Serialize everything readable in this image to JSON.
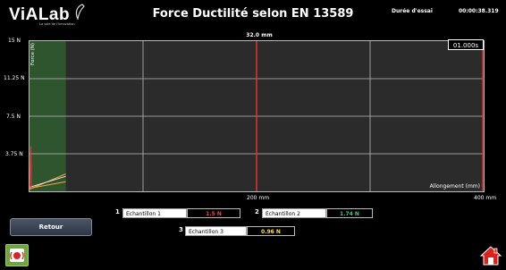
{
  "header": {
    "logo": "ViALab",
    "logo_tagline": "La voie de l'innovation",
    "title": "Force Ductilité selon EN 13589",
    "duration_label": "Durée d'essai",
    "duration_value": "00:00:38.319"
  },
  "chart_data": {
    "type": "line",
    "position_label": "32.0 mm",
    "timer": "01.000s",
    "ylabel": "Force (N)",
    "xlabel": "Allongement (mm)",
    "y_ticks": [
      "15 N",
      "11.25 N",
      "7.5 N",
      "3.75 N"
    ],
    "x_ticks": [
      "200 mm",
      "400 mm"
    ],
    "ylim": [
      0,
      15
    ],
    "xlim": [
      0,
      400
    ],
    "markers_x_mm": [
      200,
      400
    ],
    "shaded_range_mm": [
      0,
      32
    ],
    "series": [
      {
        "color": "#ffa040",
        "x": [
          0,
          32
        ],
        "y": [
          0.2,
          1.74
        ]
      },
      {
        "color": "#e8e8e8",
        "x": [
          0,
          32
        ],
        "y": [
          0.4,
          1.5
        ]
      },
      {
        "color": "#ffa040",
        "x": [
          0,
          32
        ],
        "y": [
          0.3,
          0.96
        ]
      },
      {
        "color": "#ff3030",
        "x": [
          0,
          1.2,
          1.6
        ],
        "y": [
          0,
          4.5,
          0.3
        ]
      }
    ]
  },
  "samples": [
    {
      "number": "1",
      "name": "Echantillon 1",
      "value": "1.5 N",
      "color": "#ff3b3b"
    },
    {
      "number": "2",
      "name": "Echantillon 2",
      "value": "1.74 N",
      "color": "#3ccf6a"
    },
    {
      "number": "3",
      "name": "Echantillon 3",
      "value": "0.96 N",
      "color": "#ffe14a"
    }
  ],
  "buttons": {
    "retour": "Retour",
    "alarm_icon": "alarm-icon",
    "home_icon": "home-icon"
  },
  "colors": {
    "marker_red": "#e8302a",
    "shade_green": "#2f5a2f",
    "alarm_green": "#6ea540"
  }
}
